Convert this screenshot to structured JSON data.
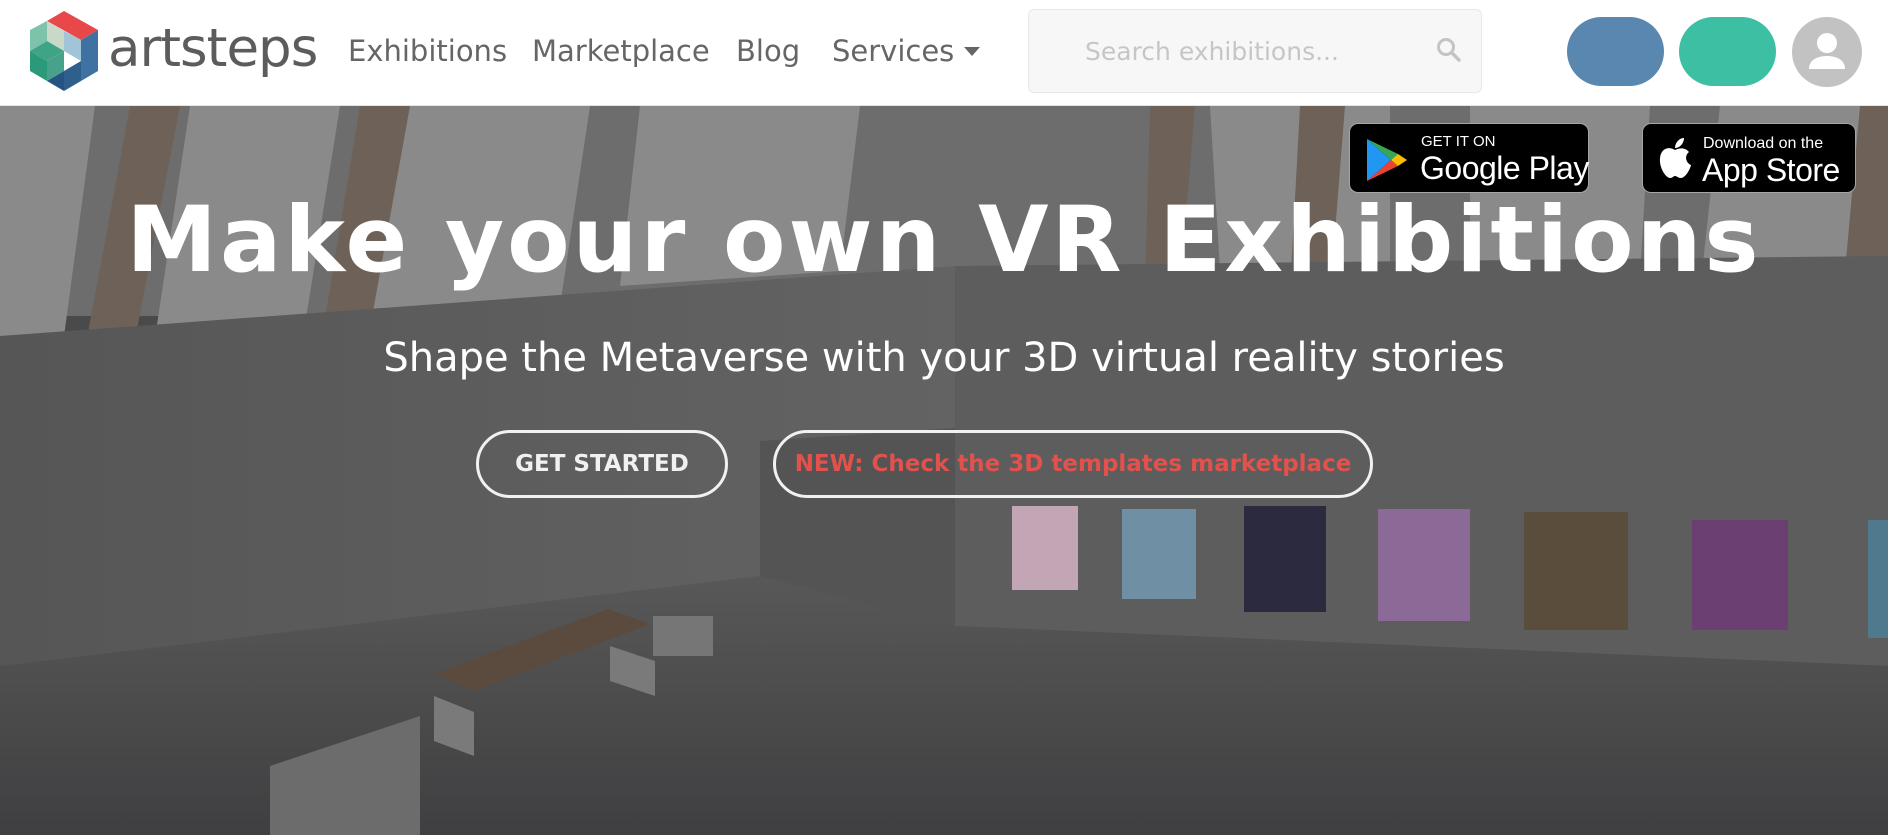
{
  "brand": {
    "name": "artsteps"
  },
  "nav": {
    "items": [
      {
        "label": "Exhibitions"
      },
      {
        "label": "Marketplace"
      },
      {
        "label": "Blog"
      },
      {
        "label": "Services"
      }
    ]
  },
  "search": {
    "placeholder": "Search exhibitions...",
    "value": ""
  },
  "hero": {
    "title": "Make your own VR Exhibitions",
    "subtitle": "Shape the Metaverse with your 3D virtual reality stories",
    "primary_button": "GET STARTED",
    "secondary_button": "NEW: Check the 3D templates marketplace"
  },
  "badges": {
    "google_play": {
      "small": "GET IT ON",
      "big": "Google Play"
    },
    "app_store": {
      "small": "Download on the",
      "big": "App Store"
    }
  },
  "colors": {
    "accent_blue": "#5a87b0",
    "accent_green": "#3dbfa4",
    "accent_red": "#e2514b",
    "nav_text": "#666666"
  },
  "icons": [
    "artsteps-logo-icon",
    "chevron-down-icon",
    "search-icon",
    "user-icon",
    "google-play-icon",
    "apple-icon"
  ]
}
